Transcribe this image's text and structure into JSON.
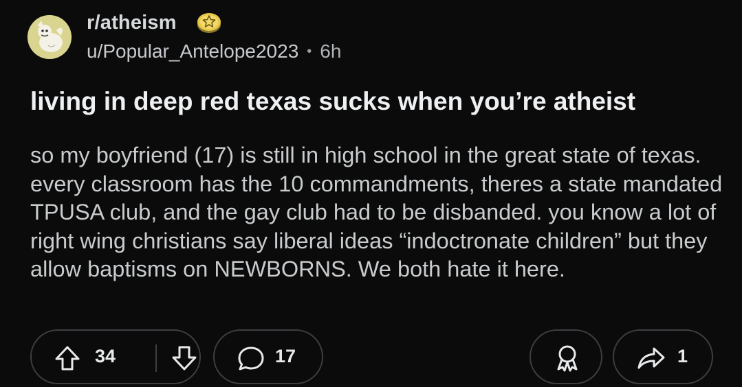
{
  "post": {
    "subreddit": "r/atheism",
    "author": "u/Popular_Antelope2023",
    "separator": "•",
    "age": "6h",
    "title": "living in deep red texas sucks when you’re atheist",
    "body": "so my boyfriend (17) is still in high school in the great state of texas. every classroom has the 10 commandments, theres a state mandated TPUSA club, and the gay club had to be disbanded. you know a lot of right wing christians say liberal ideas “indoctronate children” but they allow baptisms on NEWBORNS. We both hate it here."
  },
  "actions": {
    "upvotes": "34",
    "comments": "17",
    "shares": "1"
  },
  "icons": {
    "avatar": "subreddit-avatar-icon",
    "badge": "star-badge-icon",
    "upvote": "arrow-up-icon",
    "downvote": "arrow-down-icon",
    "comment": "comment-bubble-icon",
    "award": "award-ribbon-icon",
    "share": "share-arrow-icon"
  },
  "colors": {
    "background": "#0b0b0b",
    "title": "#eef0f2",
    "body_text": "#c9ccce",
    "pill_border": "#3c3f42",
    "badge_gold": "#e8c84a",
    "avatar_bg": "#d9d48f"
  }
}
